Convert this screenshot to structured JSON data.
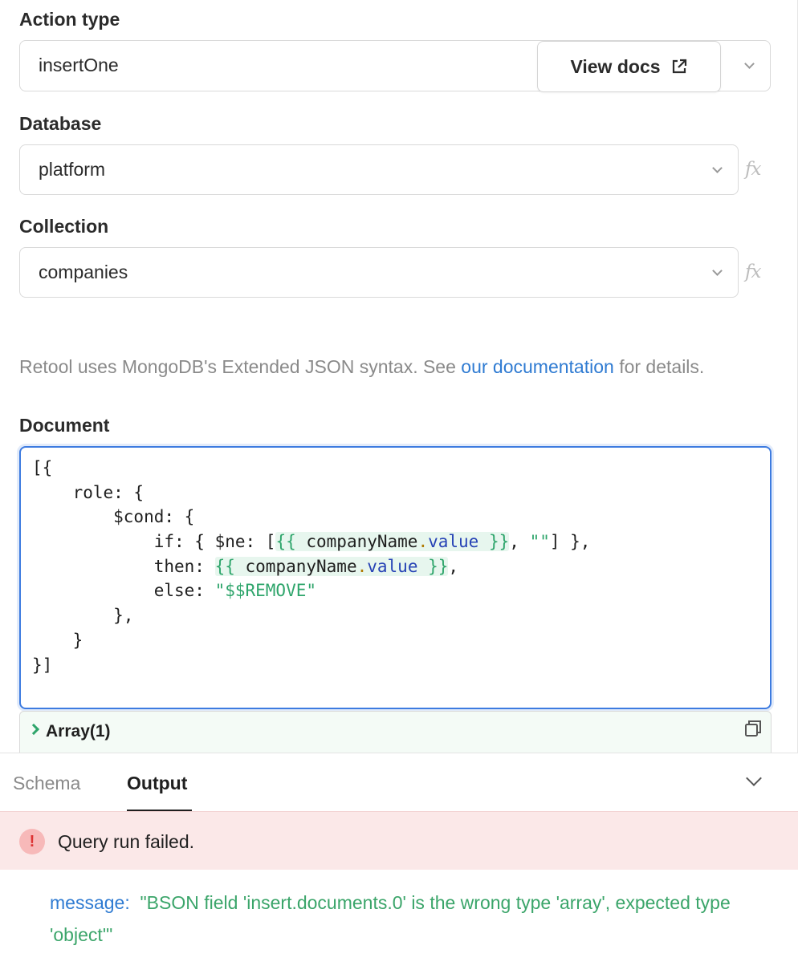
{
  "action_type": {
    "label": "Action type",
    "value": "insertOne",
    "view_docs_label": "View docs"
  },
  "database": {
    "label": "Database",
    "value": "platform",
    "fx": "fx"
  },
  "collection": {
    "label": "Collection",
    "value": "companies",
    "fx": "fx"
  },
  "help": {
    "prefix": "Retool uses MongoDB's Extended JSON syntax. See ",
    "link": "our documentation",
    "suffix": " for details."
  },
  "document": {
    "label": "Document",
    "code": {
      "l1": "[{",
      "l2": "    role: {",
      "l3": "        $cond: {",
      "l4_pre": "            if: { $ne: [",
      "l4_mid": ", ",
      "l4_str": "\"\"",
      "l4_post": "] },",
      "l5_pre": "            then: ",
      "l5_post": ",",
      "l6_pre": "            else: ",
      "l6_str": "\"$$REMOVE\"",
      "l7": "        },",
      "l8": "    }",
      "l9": "}]",
      "tpl_open": "{{ ",
      "tpl_ident": "companyName",
      "tpl_dot": ".",
      "tpl_prop": "value",
      "tpl_close": " }}"
    }
  },
  "result_preview": {
    "label": "Array(1)"
  },
  "tabs": {
    "schema": "Schema",
    "output": "Output"
  },
  "error": {
    "icon": "!",
    "text": "Query run failed."
  },
  "message": {
    "key": "message:",
    "value": "\"BSON field 'insert.documents.0' is the wrong type 'array', expected type 'object'\""
  }
}
